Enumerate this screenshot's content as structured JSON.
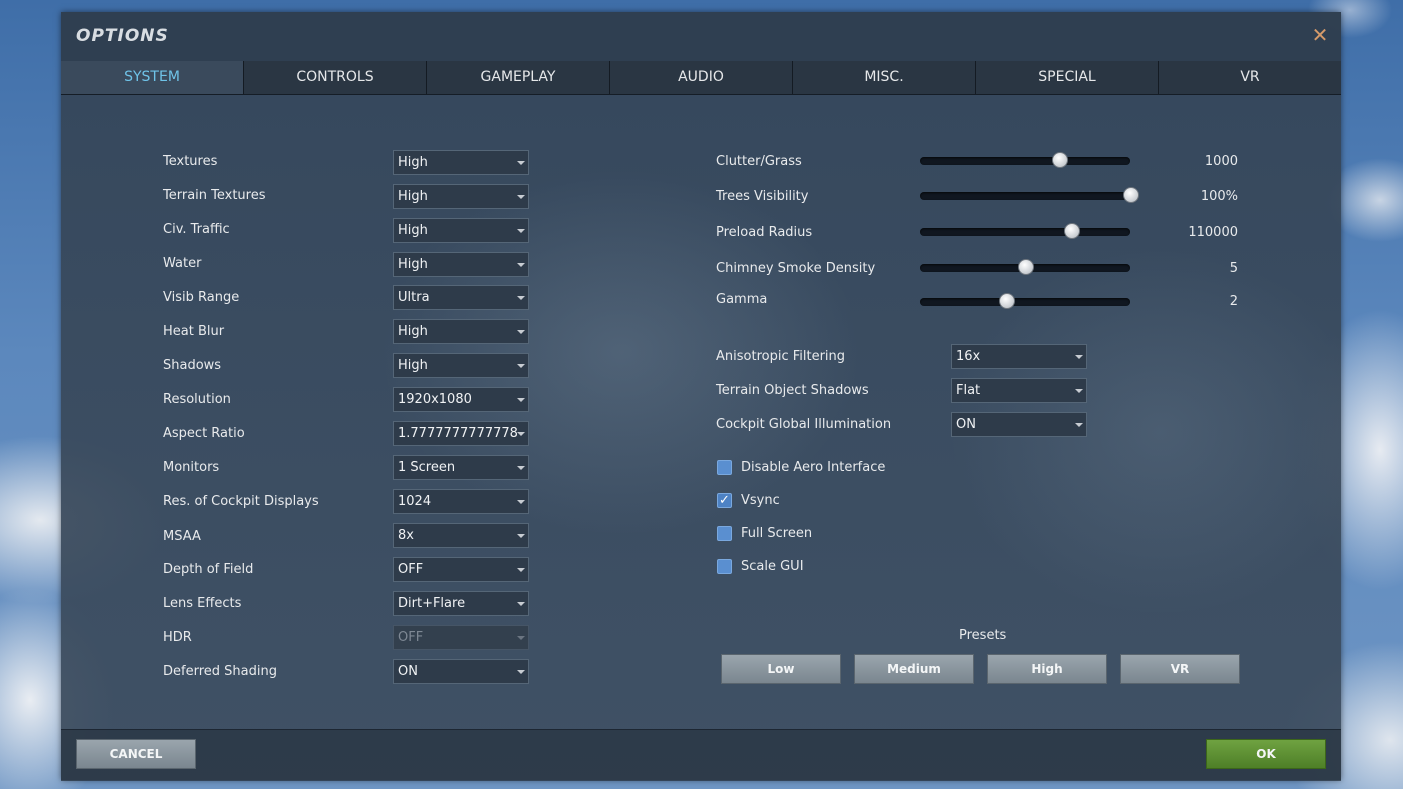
{
  "dialog": {
    "title": "OPTIONS",
    "close_glyph": "✕",
    "ok_label": "OK",
    "cancel_label": "CANCEL"
  },
  "tabs": [
    {
      "label": "SYSTEM",
      "active": true
    },
    {
      "label": "CONTROLS",
      "active": false
    },
    {
      "label": "GAMEPLAY",
      "active": false
    },
    {
      "label": "AUDIO",
      "active": false
    },
    {
      "label": "MISC.",
      "active": false
    },
    {
      "label": "SPECIAL",
      "active": false
    },
    {
      "label": "VR",
      "active": false
    }
  ],
  "left_settings": [
    {
      "label": "Textures",
      "value": "High"
    },
    {
      "label": "Terrain Textures",
      "value": "High"
    },
    {
      "label": "Civ. Traffic",
      "value": "High"
    },
    {
      "label": "Water",
      "value": "High"
    },
    {
      "label": "Visib Range",
      "value": "Ultra"
    },
    {
      "label": "Heat Blur",
      "value": "High"
    },
    {
      "label": "Shadows",
      "value": "High"
    },
    {
      "label": "Resolution",
      "value": "1920x1080"
    },
    {
      "label": "Aspect Ratio",
      "value": "1.7777777777778"
    },
    {
      "label": "Monitors",
      "value": "1 Screen"
    },
    {
      "label": "Res. of Cockpit Displays",
      "value": "1024"
    },
    {
      "label": "MSAA",
      "value": "8x"
    },
    {
      "label": "Depth of Field",
      "value": "OFF"
    },
    {
      "label": "Lens Effects",
      "value": "Dirt+Flare"
    },
    {
      "label": "HDR",
      "value": "OFF",
      "disabled": true
    },
    {
      "label": "Deferred Shading",
      "value": "ON"
    }
  ],
  "sliders": [
    {
      "label": "Clutter/Grass",
      "value_text": "1000",
      "fraction": 0.66
    },
    {
      "label": "Trees Visibility",
      "value_text": "100%",
      "fraction": 1.0
    },
    {
      "label": "Preload Radius",
      "value_text": "110000",
      "fraction": 0.72
    },
    {
      "label": "Chimney Smoke Density",
      "value_text": "5",
      "fraction": 0.5
    },
    {
      "label": "Gamma",
      "value_text": "2",
      "fraction": 0.41
    }
  ],
  "right_settings": [
    {
      "label": "Anisotropic Filtering",
      "value": "16x"
    },
    {
      "label": "Terrain Object Shadows",
      "value": "Flat"
    },
    {
      "label": "Cockpit Global Illumination",
      "value": "ON"
    }
  ],
  "checkboxes": [
    {
      "label": "Disable Aero Interface",
      "checked": false
    },
    {
      "label": "Vsync",
      "checked": true
    },
    {
      "label": "Full Screen",
      "checked": false
    },
    {
      "label": "Scale GUI",
      "checked": false
    }
  ],
  "presets": {
    "title": "Presets",
    "buttons": [
      "Low",
      "Medium",
      "High",
      "VR"
    ]
  },
  "icons": {
    "close": "close-icon",
    "dropdown": "chevron-down-icon",
    "check": "checkmark-icon"
  },
  "colors": {
    "active_tab": "#6fc3e8",
    "ok_button": "#5f9134",
    "checkbox": "#5a8fd0",
    "close": "#d59a6a"
  }
}
